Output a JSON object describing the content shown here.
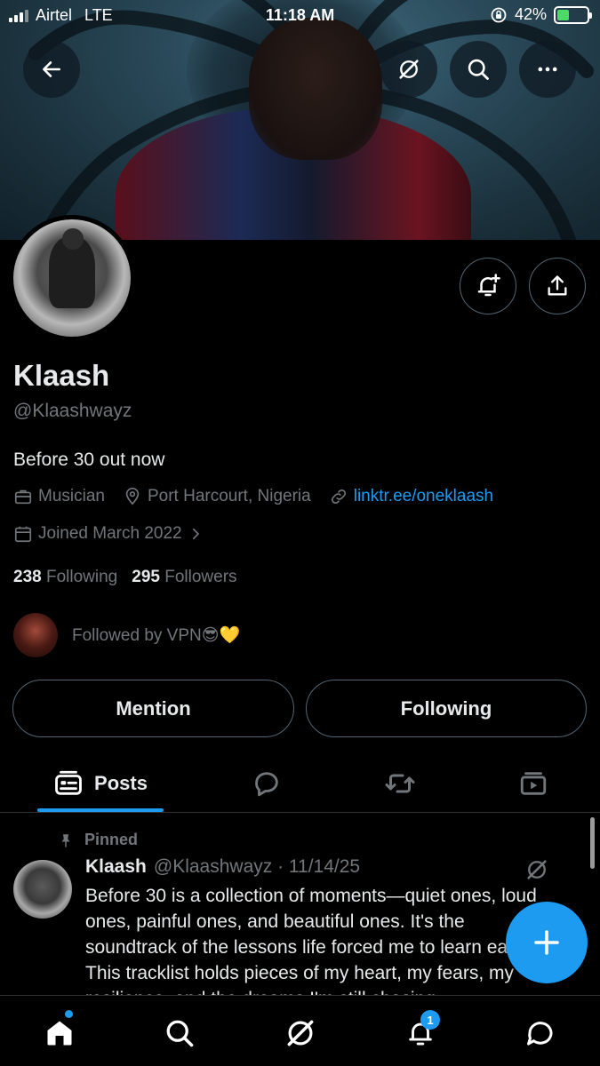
{
  "status_bar": {
    "carrier": "Airtel",
    "network": "LTE",
    "time": "11:18 AM",
    "battery": "42%",
    "battery_level": 0.42
  },
  "header": {
    "back_icon": "arrow-left-icon",
    "grok_icon": "grok-icon",
    "search_icon": "search-icon",
    "more_icon": "more-icon"
  },
  "profile": {
    "name": "Klaash",
    "handle": "@Klaashwayz",
    "bio": "Before 30 out now",
    "category": "Musician",
    "location": "Port Harcourt, Nigeria",
    "link": "linktr.ee/oneklaash",
    "joined": "Joined March 2022",
    "following_count": "238",
    "following_label": "Following",
    "followers_count": "295",
    "followers_label": "Followers",
    "followed_by": "Followed by VPN😎💛"
  },
  "actions": {
    "mention": "Mention",
    "following": "Following"
  },
  "tabs": {
    "posts": "Posts"
  },
  "post": {
    "pinned_label": "Pinned",
    "author": "Klaash",
    "handle_date": "@Klaashwayz · 11/14/25",
    "text": "Before 30 is a collection of moments—quiet ones, loud ones, painful ones, and beautiful ones. It's the soundtrack of the lessons life forced me to learn early. This tracklist holds pieces of my heart, my fears, my resilience, and the dreams I'm still chasing."
  },
  "bottom_nav": {
    "notifications_badge": "1"
  },
  "colors": {
    "accent": "#1d9bf0",
    "muted": "#71767b",
    "border": "#536471"
  }
}
